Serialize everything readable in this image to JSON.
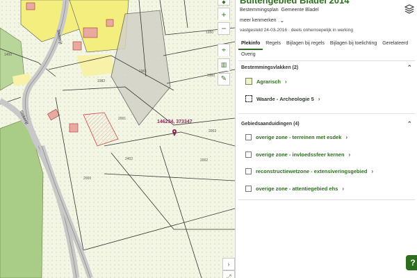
{
  "plan": {
    "title": "Buitengebied Bladel 2014",
    "type_label": "Bestemmingsplan",
    "municipality": "Gemeente Bladel",
    "more_label": "meer kenmerken",
    "date_text": "vastgesteld 24-03-2016 · deels onherroepelijk in werking"
  },
  "tabs": [
    {
      "label": "Plekinfo",
      "active": true
    },
    {
      "label": "Regels",
      "active": false
    },
    {
      "label": "Bijlagen bij regels",
      "active": false
    },
    {
      "label": "Bijlagen bij toelichting",
      "active": false
    },
    {
      "label": "Gerelateerd",
      "active": false
    },
    {
      "label": "Overig",
      "active": false
    }
  ],
  "bestemmingsvlakken": {
    "title": "Bestemmingsvlakken (2)",
    "items": [
      {
        "label": "Agrarisch"
      },
      {
        "label": "Waarde - Archeologie 5"
      }
    ]
  },
  "gebiedsaanduidingen": {
    "title": "Gebiedsaanduidingen (4)",
    "items": [
      {
        "label": "overige zone - terreinen met esdek"
      },
      {
        "label": "overige zone - invloedssfeer kernen"
      },
      {
        "label": "reconstructiewetzone - extensiveringsgebied"
      },
      {
        "label": "overige zone - attentiegebied ehs"
      }
    ]
  },
  "map": {
    "coordinate": "146234, 373347",
    "road_name_1": "Stokerijt",
    "road_name_2": "Stokerijt",
    "plot_numbers": [
      "1400",
      "1950",
      "2402",
      "1961",
      "1960",
      "2001",
      "2003",
      "2002",
      "1982",
      "2000"
    ]
  },
  "colors": {
    "accent": "#2d6d1e",
    "agrarisch": "#eef3c9",
    "bos": "#a9cc86",
    "wonen": "#f4ee7f",
    "marker": "#8a2a5a"
  }
}
